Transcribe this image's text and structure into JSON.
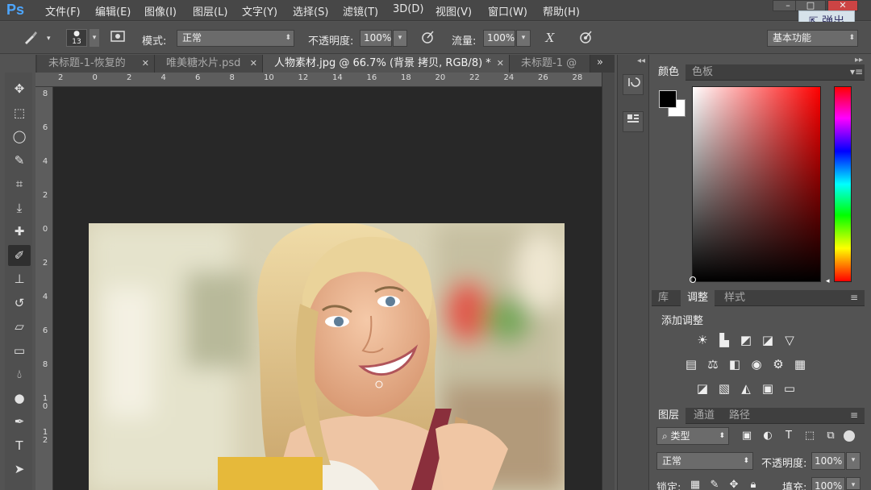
{
  "app": {
    "logo": "Ps",
    "menu": [
      "文件(F)",
      "编辑(E)",
      "图像(I)",
      "图层(L)",
      "文字(Y)",
      "选择(S)",
      "滤镜(T)",
      "3D(D)",
      "视图(V)",
      "窗口(W)",
      "帮助(H)"
    ],
    "float_button": "弹出",
    "window_buttons": [
      "–",
      "□",
      "✕"
    ]
  },
  "options_bar": {
    "brush_size": "13",
    "mode_label": "模式:",
    "mode_value": "正常",
    "opacity_label": "不透明度:",
    "opacity_value": "100%",
    "flow_label": "流量:",
    "flow_value": "100%",
    "workspace": "基本功能"
  },
  "tabs": [
    {
      "label": "未标题-1-恢复的",
      "active": false
    },
    {
      "label": "唯美糖水片.psd",
      "active": false
    },
    {
      "label": "人物素材.jpg @ 66.7% (背景 拷贝, RGB/8) *",
      "active": true
    },
    {
      "label": "未标题-1 @",
      "active": false
    }
  ],
  "tab_overflow": "»",
  "ruler": {
    "h_ticks": [
      "2",
      "0",
      "2",
      "4",
      "6",
      "8",
      "10",
      "12",
      "14",
      "16",
      "18",
      "20",
      "22",
      "24",
      "26",
      "28"
    ],
    "v_ticks": [
      "8",
      "6",
      "4",
      "2",
      "0",
      "2",
      "4",
      "6",
      "8",
      "1\n0",
      "1\n2"
    ]
  },
  "toolbox": [
    "move-tool",
    "marquee-tool",
    "lasso-tool",
    "quick-select-tool",
    "crop-tool",
    "eyedropper-tool",
    "healing-brush-tool",
    "brush-tool",
    "clone-stamp-tool",
    "history-brush-tool",
    "eraser-tool",
    "gradient-tool",
    "blur-tool",
    "dodge-tool",
    "pen-tool",
    "type-tool",
    "path-select-tool"
  ],
  "selected_tool": "brush-tool",
  "panels": {
    "color": {
      "tabs": [
        "颜色",
        "色板"
      ],
      "foreground": "#000000",
      "background": "#ffffff"
    },
    "adjust": {
      "tabs": [
        "库",
        "调整",
        "样式"
      ],
      "title": "添加调整"
    },
    "layers": {
      "tabs": [
        "图层",
        "通道",
        "路径"
      ],
      "filter_label": "类型",
      "blend_mode": "正常",
      "opacity_label": "不透明度:",
      "opacity_value": "100%",
      "lock_label": "锁定:",
      "fill_label": "填充:",
      "fill_value": "100%"
    }
  },
  "colors": {
    "accent": "#4da6ff",
    "chrome": "#535353",
    "canvas": "#282828"
  }
}
